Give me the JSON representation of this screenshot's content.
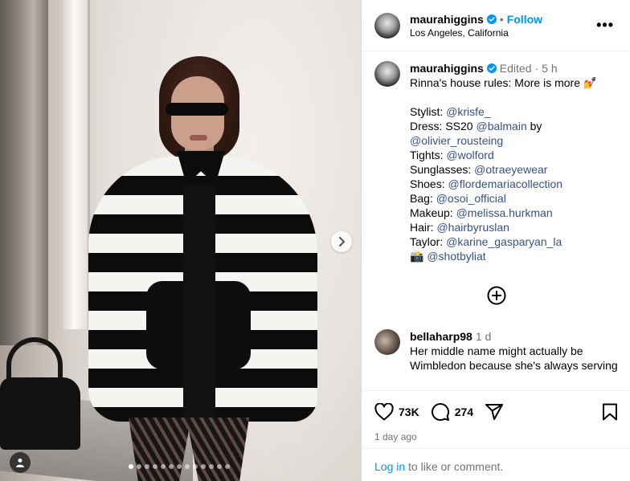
{
  "post": {
    "username": "maurahiggins",
    "follow_label": "Follow",
    "separator": "•",
    "location": "Los Angeles, California",
    "more_label": "•••"
  },
  "caption": {
    "username": "maurahiggins",
    "edited": "Edited",
    "dot": "·",
    "time": "5 h",
    "title": "Rinna's house rules: More is more 💅",
    "lines": [
      {
        "label": "Stylist: ",
        "mention": "@krisfe_"
      },
      {
        "label": "Dress: SS20 ",
        "mention": "@balmain",
        "suffix": " by"
      },
      {
        "label": "",
        "mention": "@olivier_rousteing"
      },
      {
        "label": "Tights: ",
        "mention": "@wolford"
      },
      {
        "label": "Sunglasses: ",
        "mention": "@otraeyewear"
      },
      {
        "label": "Shoes: ",
        "mention": "@flordemariacollection"
      },
      {
        "label": "Bag: ",
        "mention": "@osoi_official"
      },
      {
        "label": "Makeup: ",
        "mention": "@melissa.hurkman"
      },
      {
        "label": "Hair: ",
        "mention": "@hairbyruslan"
      },
      {
        "label": "Taylor: ",
        "mention": "@karine_gasparyan_la"
      },
      {
        "label": "📸 ",
        "mention": "@shotbyliat"
      }
    ]
  },
  "comment": {
    "username": "bellaharp98",
    "time": "1 d",
    "text": "Her middle name might actually be Wimbledon because she's always serving"
  },
  "actions": {
    "likes": "73K",
    "comments": "274",
    "posted": "1 day ago"
  },
  "login": {
    "link": "Log in",
    "rest": " to like or comment."
  },
  "carousel": {
    "total": 13,
    "active_index": 0
  },
  "colors": {
    "link_blue": "#0095f6",
    "mention_blue": "#385185",
    "muted": "#737373",
    "verified_blue": "#0095f6"
  }
}
